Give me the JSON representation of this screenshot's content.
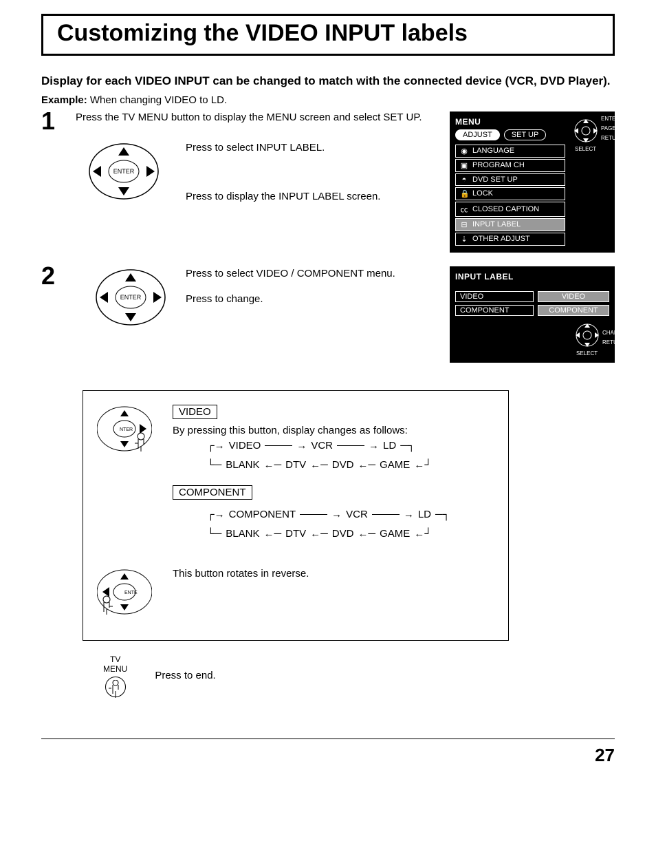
{
  "title": "Customizing the VIDEO INPUT labels",
  "intro": "Display for each VIDEO INPUT can be changed to match with the connected device (VCR, DVD Player).",
  "example_label": "Example:",
  "example_text": " When changing VIDEO to LD.",
  "step1": {
    "num": "1",
    "line1": "Press the TV MENU button to display the MENU screen and select SET UP.",
    "press_select": "Press to select INPUT LABEL.",
    "press_display": "Press to display the INPUT LABEL screen."
  },
  "step2": {
    "num": "2",
    "press_select": "Press to select VIDEO / COMPONENT menu.",
    "press_change": "Press to change."
  },
  "osd1": {
    "title": "MENU",
    "tab1": "ADJUST",
    "tab2": "SET UP",
    "items": [
      "LANGUAGE",
      "PROGRAM CH",
      "DVD SET UP",
      "LOCK",
      "CLOSED CAPTION",
      "INPUT LABEL",
      "OTHER ADJUST"
    ],
    "dpad": {
      "enter": "ENTER",
      "page": "PAGE",
      "return": "RETURN",
      "select": "SELECT"
    }
  },
  "osd2": {
    "title": "INPUT LABEL",
    "rows": [
      {
        "name": "VIDEO",
        "val": "VIDEO"
      },
      {
        "name": "COMPONENT",
        "val": "COMPONENT"
      }
    ],
    "dpad": {
      "change": "CHANGE",
      "return": "RETURN",
      "select": "SELECT"
    }
  },
  "cycle": {
    "video_label": "VIDEO",
    "video_intro": "By pressing this button, display changes as follows:",
    "video_forward": [
      "VIDEO",
      "VCR",
      "LD"
    ],
    "video_back": [
      "BLANK",
      "DTV",
      "DVD",
      "GAME"
    ],
    "component_label": "COMPONENT",
    "component_forward": [
      "COMPONENT",
      "VCR",
      "LD"
    ],
    "component_back": [
      "BLANK",
      "DTV",
      "DVD",
      "GAME"
    ],
    "reverse": "This button rotates in reverse."
  },
  "end": {
    "tv": "TV",
    "menu": "MENU",
    "press_end": "Press to end."
  },
  "page_number": "27",
  "enter_label": "ENTER"
}
